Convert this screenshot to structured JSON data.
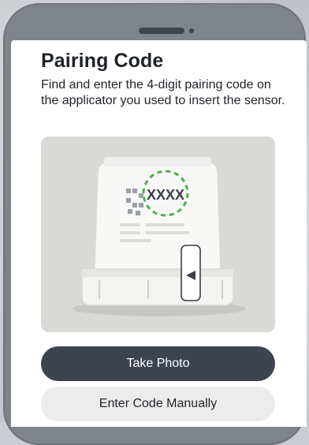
{
  "screen": {
    "title": "Pairing Code",
    "instructions": "Find and enter the 4-digit pairing code on the applicator you used to insert the sensor."
  },
  "illustration": {
    "code_text": "XXXX",
    "highlight_color": "#4caf50"
  },
  "actions": {
    "take_photo_label": "Take Photo",
    "enter_manually_label": "Enter Code Manually"
  }
}
